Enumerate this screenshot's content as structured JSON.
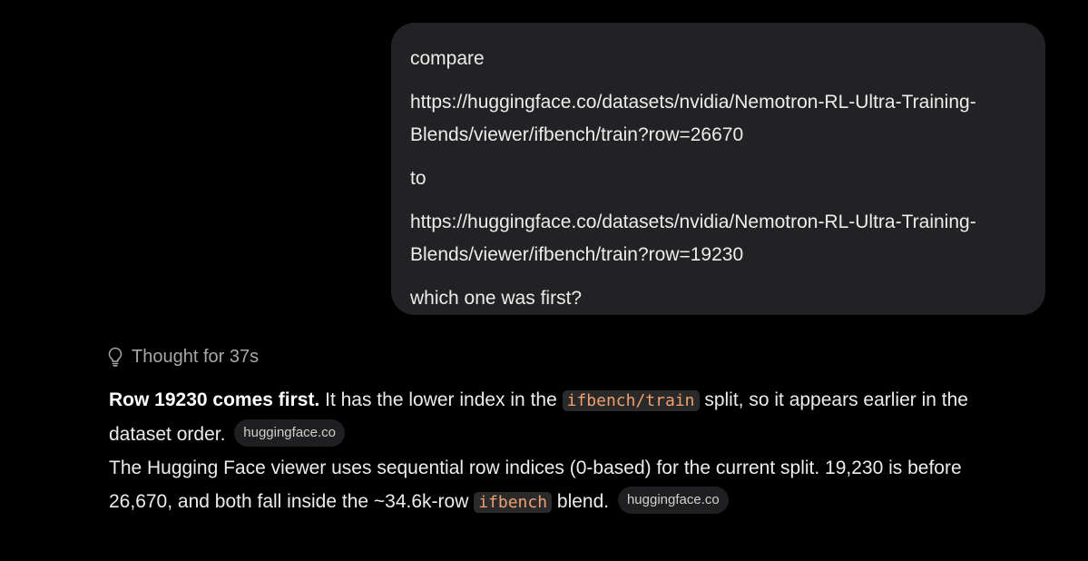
{
  "user_message": {
    "line_compare": "compare",
    "url_1_part1": "https://huggingface.co/datasets/nvidia/Nemotron-RL-Ultra-Training-",
    "url_1_part2": "Blends/viewer/ifbench/train?row=26670",
    "line_to": "to",
    "url_2_part1": "https://huggingface.co/datasets/nvidia/Nemotron-RL-Ultra-Training-",
    "url_2_part2": "Blends/viewer/ifbench/train?row=19230",
    "question": "which one was first?"
  },
  "thought": {
    "icon": "lightbulb-icon",
    "label": "Thought for 37s"
  },
  "response": {
    "p1_bold": "Row 19230 comes first.",
    "p1_text_a": " It has the lower index in the ",
    "p1_code": "ifbench/train",
    "p1_text_b": " split, so it appears earlier in the dataset order.",
    "p1_source": "huggingface.co",
    "p2_text_a": "The Hugging Face viewer uses sequential row indices (0-based) for the current split. 19,230 is before 26,670, and both fall inside the ~34.6k-row ",
    "p2_code": "ifbench",
    "p2_text_b": " blend.",
    "p2_source": "huggingface.co"
  },
  "colors": {
    "background": "#000000",
    "bubble": "#222225",
    "code_text": "#f0a070",
    "code_bg": "#2a2a2a",
    "muted": "#a8a8a8"
  }
}
